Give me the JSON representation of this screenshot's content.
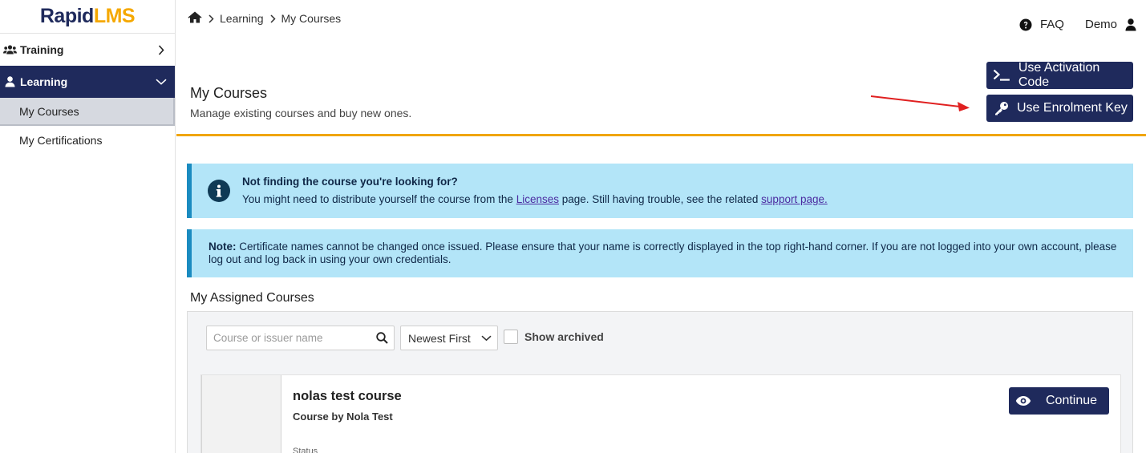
{
  "brand": {
    "logo_part1": "Rapid",
    "logo_part2": "LMS",
    "color_primary": "#1f2a5c",
    "color_accent": "#f5a800"
  },
  "sidebar": {
    "items": [
      {
        "label": "Training",
        "icon": "users-icon",
        "chevron": "chevron-right-icon"
      },
      {
        "label": "Learning",
        "icon": "user-icon",
        "chevron": "chevron-down-icon"
      }
    ],
    "subitems": [
      {
        "label": "My Courses"
      },
      {
        "label": "My Certifications"
      }
    ]
  },
  "breadcrumb": {
    "items": [
      "Learning",
      "My Courses"
    ]
  },
  "topbar": {
    "faq_label": "FAQ",
    "user_name": "Demo"
  },
  "header": {
    "title": "My Courses",
    "subtitle": "Manage existing courses and buy new ones.",
    "activation_button": "Use Activation Code",
    "enrolment_button": "Use Enrolment Key",
    "divider_color": "#f0a500"
  },
  "alerts": {
    "info_title": "Not finding the course you're looking for?",
    "info_text_before": "You might need to distribute yourself the course from the ",
    "info_link1": "Licenses",
    "info_text_middle": " page. Still having trouble, see the related ",
    "info_link2": "support page.",
    "note_label": "Note:",
    "note_text": " Certificate names cannot be changed once issued. Please ensure that your name is correctly displayed in the top right-hand corner. If you are not logged into your own account, please log out and log back in using your own credentials."
  },
  "assigned": {
    "title": "My Assigned Courses",
    "search_placeholder": "Course or issuer name",
    "sort_value": "Newest First",
    "show_archived_label": "Show archived"
  },
  "courses": [
    {
      "title": "nolas test course",
      "by": "Course by Nola Test",
      "status_label": "Status",
      "action": "Continue"
    }
  ]
}
